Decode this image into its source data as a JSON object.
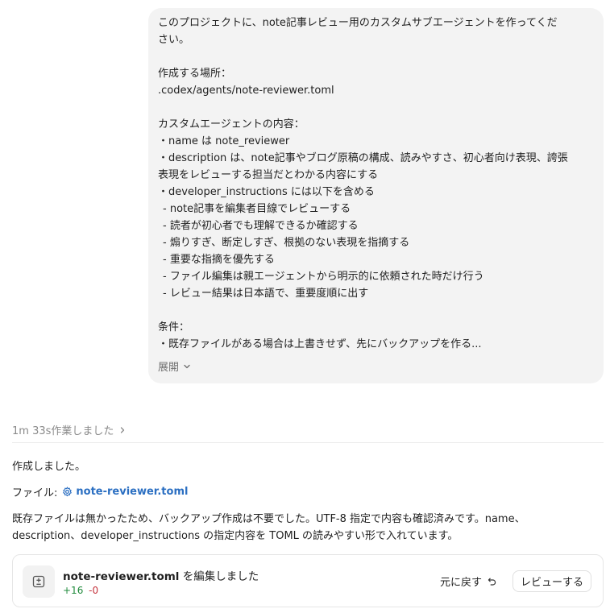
{
  "message": {
    "lines": [
      "このプロジェクトに、note記事レビュー用のカスタムサブエージェントを作ってくだ",
      "さい。",
      "",
      "作成する場所：",
      ".codex/agents/note-reviewer.toml",
      "",
      "カスタムエージェントの内容：",
      "・name は note_reviewer",
      "・description は、note記事やブログ原稿の構成、読みやすさ、初心者向け表現、誇張",
      "表現をレビューする担当だとわかる内容にする",
      "・developer_instructions には以下を含める",
      " - note記事を編集者目線でレビューする",
      " - 読者が初心者でも理解できるか確認する",
      " - 煽りすぎ、断定しすぎ、根拠のない表現を指摘する",
      " - 重要な指摘を優先する",
      " - ファイル編集は親エージェントから明示的に依頼された時だけ行う",
      " - レビュー結果は日本語で、重要度順に出す",
      "",
      "条件：",
      "・既存ファイルがある場合は上書きせず、先にバックアップを作る..."
    ],
    "expand_label": "展開"
  },
  "worked": {
    "label": "1m 33s作業しました"
  },
  "response": {
    "created": "作成しました。",
    "file_label": "ファイル:",
    "file_name": "note-reviewer.toml",
    "summary_line1": "既存ファイルは無かったため、バックアップ作成は不要でした。UTF-8 指定で内容も確認済みです。name、",
    "summary_line2": "description、developer_instructions の指定内容を TOML の読みやすい形で入れています。"
  },
  "edit_card": {
    "file": "note-reviewer.toml",
    "action": " を編集しました",
    "additions": "+16",
    "deletions": "-0",
    "undo_label": "元に戻す",
    "review_label": "レビューする"
  },
  "colors": {
    "bubble_bg": "#f3f3f3",
    "link": "#2b6fc2",
    "additions": "#1f8a3b",
    "deletions": "#c4313b"
  }
}
